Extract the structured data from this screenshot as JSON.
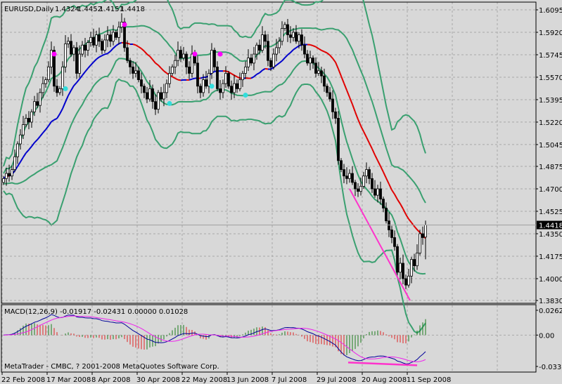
{
  "header": {
    "symbol": "EURUSD,Daily",
    "open": "1.4324",
    "high": "1.4452",
    "low": "1.4151",
    "close": "1.4418"
  },
  "current_price_label": "1.4418",
  "copyright": "MetaTrader - CMBC, ? 2001-2008 MetaQuotes Software Corp.",
  "macd_label": "MACD(12,26,9) -0.01917 -0.02431 0.00000 0.01028",
  "colors": {
    "background": "#d8d8d8",
    "bands": "#3aa070",
    "ma_up": "#0000cc",
    "ma_down": "#e00000",
    "divergence": "#ff33cc",
    "dot_magenta": "#ff00ff",
    "dot_cyan": "#33dddd",
    "hist_up": "#1a7a1a",
    "hist_down": "#e02020"
  },
  "chart_data": {
    "type": "candlestick",
    "title": "EURUSD,Daily",
    "price_axis": {
      "ticks": [
        "1.6095",
        "1.5920",
        "1.5745",
        "1.5570",
        "1.5395",
        "1.5220",
        "1.5045",
        "1.4875",
        "1.4700",
        "1.4525",
        "1.4350",
        "1.4175",
        "1.4000",
        "1.3830"
      ],
      "range": [
        1.383,
        1.6095
      ]
    },
    "date_labels": [
      {
        "bar": 0,
        "label": "22 Feb 2008"
      },
      {
        "bar": 16,
        "label": "17 Mar 2008"
      },
      {
        "bar": 32,
        "label": "8 Apr 2008"
      },
      {
        "bar": 48,
        "label": "30 Apr 2008"
      },
      {
        "bar": 64,
        "label": "22 May 2008"
      },
      {
        "bar": 80,
        "label": "13 Jun 2008"
      },
      {
        "bar": 96,
        "label": "7 Jul 2008"
      },
      {
        "bar": 112,
        "label": "29 Jul 2008"
      },
      {
        "bar": 128,
        "label": "20 Aug 2008"
      },
      {
        "bar": 144,
        "label": "11 Sep 2008"
      }
    ],
    "closes": [
      1.478,
      1.482,
      1.48,
      1.485,
      1.495,
      1.505,
      1.512,
      1.52,
      1.525,
      1.522,
      1.53,
      1.538,
      1.535,
      1.545,
      1.552,
      1.555,
      1.565,
      1.578,
      1.55,
      1.545,
      1.548,
      1.565,
      1.583,
      1.585,
      1.575,
      1.58,
      1.56,
      1.575,
      1.582,
      1.578,
      1.584,
      1.588,
      1.582,
      1.59,
      1.585,
      1.578,
      1.586,
      1.59,
      1.585,
      1.592,
      1.588,
      1.596,
      1.6,
      1.58,
      1.57,
      1.565,
      1.56,
      1.562,
      1.555,
      1.55,
      1.545,
      1.54,
      1.548,
      1.538,
      1.532,
      1.545,
      1.54,
      1.545,
      1.552,
      1.56,
      1.565,
      1.57,
      1.578,
      1.572,
      1.575,
      1.565,
      1.56,
      1.575,
      1.568,
      1.55,
      1.545,
      1.555,
      1.55,
      1.56,
      1.578,
      1.565,
      1.548,
      1.545,
      1.552,
      1.56,
      1.55,
      1.545,
      1.552,
      1.548,
      1.555,
      1.56,
      1.565,
      1.572,
      1.568,
      1.575,
      1.582,
      1.578,
      1.59,
      1.585,
      1.57,
      1.565,
      1.575,
      1.58,
      1.585,
      1.595,
      1.598,
      1.59,
      1.588,
      1.592,
      1.585,
      1.59,
      1.582,
      1.575,
      1.568,
      1.572,
      1.568,
      1.56,
      1.562,
      1.558,
      1.55,
      1.545,
      1.54,
      1.53,
      1.525,
      1.492,
      1.485,
      1.48,
      1.478,
      1.482,
      1.475,
      1.47,
      1.468,
      1.472,
      1.48,
      1.485,
      1.478,
      1.47,
      1.465,
      1.47,
      1.462,
      1.455,
      1.445,
      1.438,
      1.432,
      1.425,
      1.405,
      1.412,
      1.4,
      1.395,
      1.402,
      1.415,
      1.41,
      1.42,
      1.435,
      1.432,
      1.4418
    ],
    "last_bar": {
      "open": 1.4324,
      "high": 1.4452,
      "low": 1.4151,
      "close": 1.4418
    },
    "signal_dots": [
      {
        "bar": 18,
        "price": 1.575,
        "color": "magenta"
      },
      {
        "bar": 43,
        "price": 1.598,
        "color": "magenta"
      },
      {
        "bar": 68,
        "price": 1.575,
        "color": "magenta"
      },
      {
        "bar": 77,
        "price": 1.575,
        "color": "magenta"
      },
      {
        "bar": 22,
        "price": 1.548,
        "color": "cyan"
      },
      {
        "bar": 59,
        "price": 1.5365,
        "color": "cyan"
      },
      {
        "bar": 74,
        "price": 1.55,
        "color": "cyan"
      },
      {
        "bar": 86,
        "price": 1.543,
        "color": "cyan"
      }
    ],
    "price_divergence_line": {
      "from": {
        "bar": 123,
        "price": 1.47
      },
      "to": {
        "bar": 144.5,
        "price": 1.383
      }
    },
    "macd": {
      "params": [
        12,
        26,
        9
      ],
      "values": {
        "macd": -0.01917,
        "signal": -0.02431,
        "zero": 0.0,
        "hist": 0.01028
      },
      "axis_ticks": [
        "0.02625",
        "0.00",
        "-0.03321"
      ],
      "range": [
        -0.03321,
        0.02625
      ],
      "divergence_line": {
        "from": {
          "bar": 122.5,
          "value": -0.029
        },
        "to": {
          "bar": 147,
          "value": -0.032
        }
      }
    }
  }
}
